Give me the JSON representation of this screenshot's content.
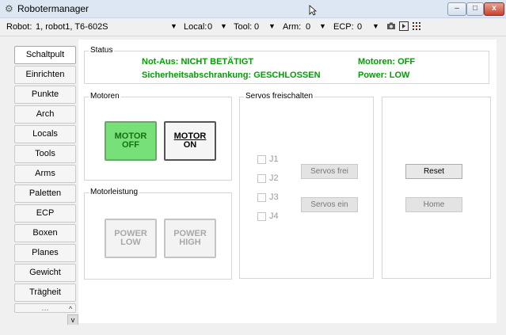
{
  "window": {
    "title": "Robotermanager",
    "minimize": "–",
    "maximize": "□",
    "close": "x"
  },
  "toolbar": {
    "robot_label": "Robot:",
    "robot_value": "1, robot1, T6-602S",
    "local_label": "Local:",
    "local_value": "0",
    "tool_label": "Tool:",
    "tool_value": "0",
    "arm_label": "Arm:",
    "arm_value": "0",
    "ecp_label": "ECP:",
    "ecp_value": "0",
    "dropdown_arrow": "▼"
  },
  "nav": {
    "items": [
      "Schaltpult",
      "Einrichten",
      "Punkte",
      "Arch",
      "Locals",
      "Tools",
      "Arms",
      "Paletten",
      "ECP",
      "Boxen",
      "Planes",
      "Gewicht",
      "Trägheit"
    ],
    "active": "Schaltpult",
    "partial_item": "...",
    "scroll_up": "^",
    "scroll_down": "v"
  },
  "status": {
    "label": "Status",
    "not_aus": "Not-Aus: NICHT BETÄTIGT",
    "sicherheit": "Sicherheitsabschrankung: GESCHLOSSEN",
    "motoren": "Motoren: OFF",
    "power": "Power: LOW"
  },
  "motoren": {
    "label": "Motoren",
    "off_line1": "MOTOR",
    "off_line2": "OFF",
    "on_line1": "MOTOR",
    "on_line2": "ON"
  },
  "motorleistung": {
    "label": "Motorleistung",
    "low_line1": "POWER",
    "low_line2": "LOW",
    "high_line1": "POWER",
    "high_line2": "HIGH"
  },
  "servos": {
    "label": "Servos freischalten",
    "joints": [
      "J1",
      "J2",
      "J3",
      "J4"
    ],
    "frei": "Servos frei",
    "ein": "Servos ein"
  },
  "actions": {
    "reset": "Reset",
    "home": "Home"
  },
  "colors": {
    "status_green": "#00a000",
    "motor_off_bg": "#78e078"
  }
}
